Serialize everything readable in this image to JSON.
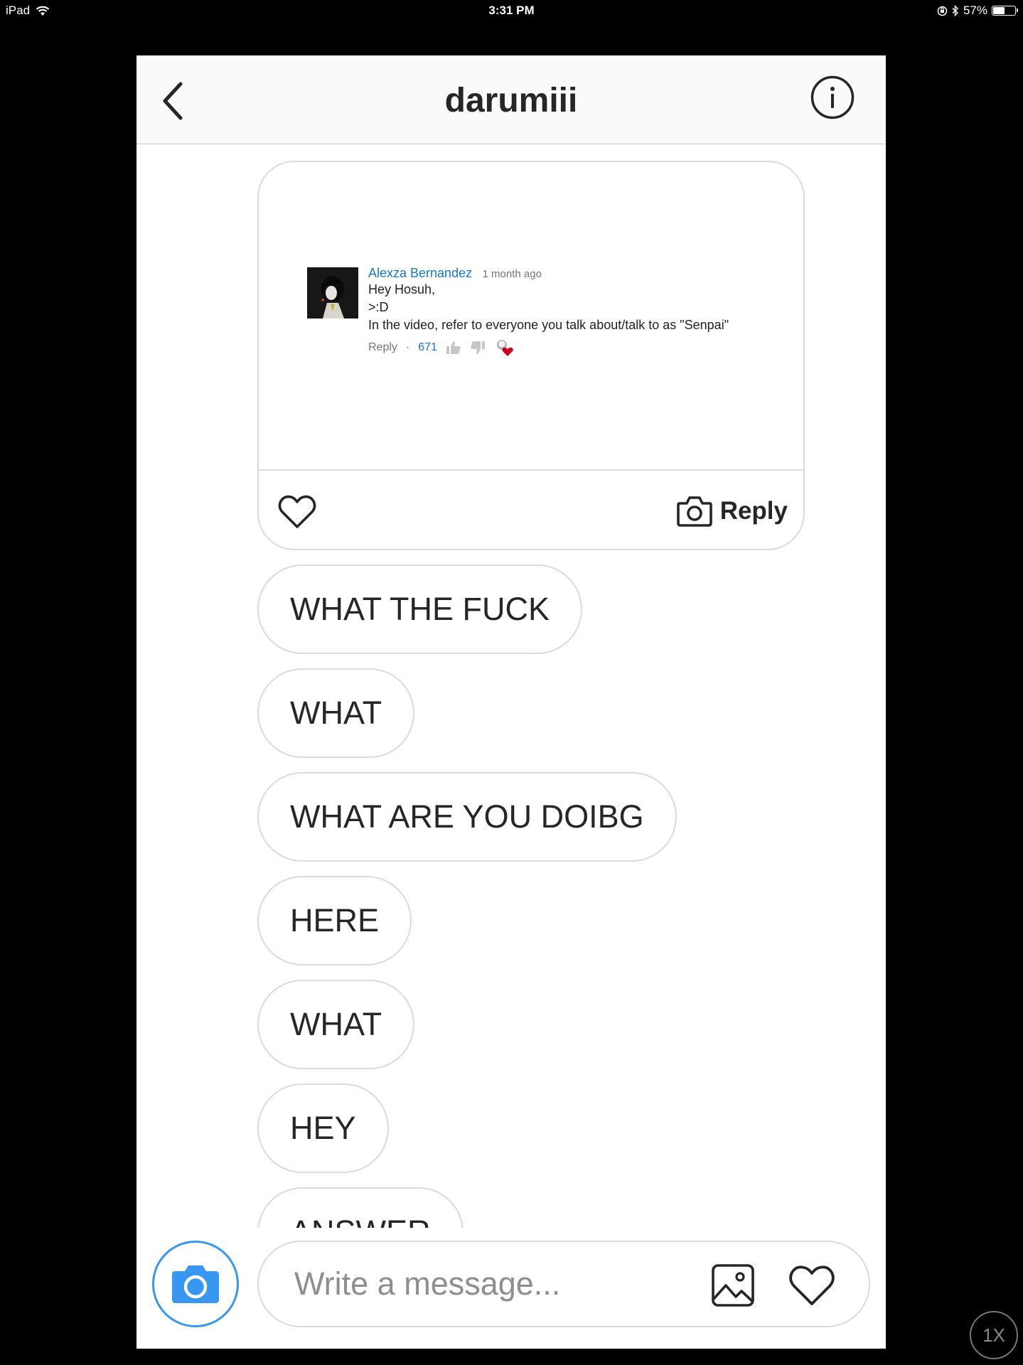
{
  "status_bar": {
    "device": "iPad",
    "time": "3:31 PM",
    "battery": "57%",
    "battery_level": 0.57
  },
  "header": {
    "title": "darumiii"
  },
  "shared_post": {
    "comment": {
      "author": "Alexza Bernandez",
      "time": "1 month ago",
      "lines": [
        "Hey Hosuh,",
        ">:D",
        "In the video, refer to everyone you talk about/talk to as \"Senpai\""
      ],
      "reply_label": "Reply",
      "separator": "·",
      "like_count": "671"
    },
    "reply_label": "Reply"
  },
  "messages": [
    {
      "text": "WHAT THE FUCK"
    },
    {
      "text": "WHAT"
    },
    {
      "text": "WHAT ARE YOU DOIBG"
    },
    {
      "text": "HERE"
    },
    {
      "text": "WHAT"
    },
    {
      "text": "HEY"
    },
    {
      "text": "ANSWER"
    }
  ],
  "composer": {
    "placeholder": "Write a message..."
  },
  "zoom_indicator": "1X",
  "colors": {
    "accent": "#3897f0",
    "link": "#167ac6",
    "heart": "#d0021b"
  }
}
